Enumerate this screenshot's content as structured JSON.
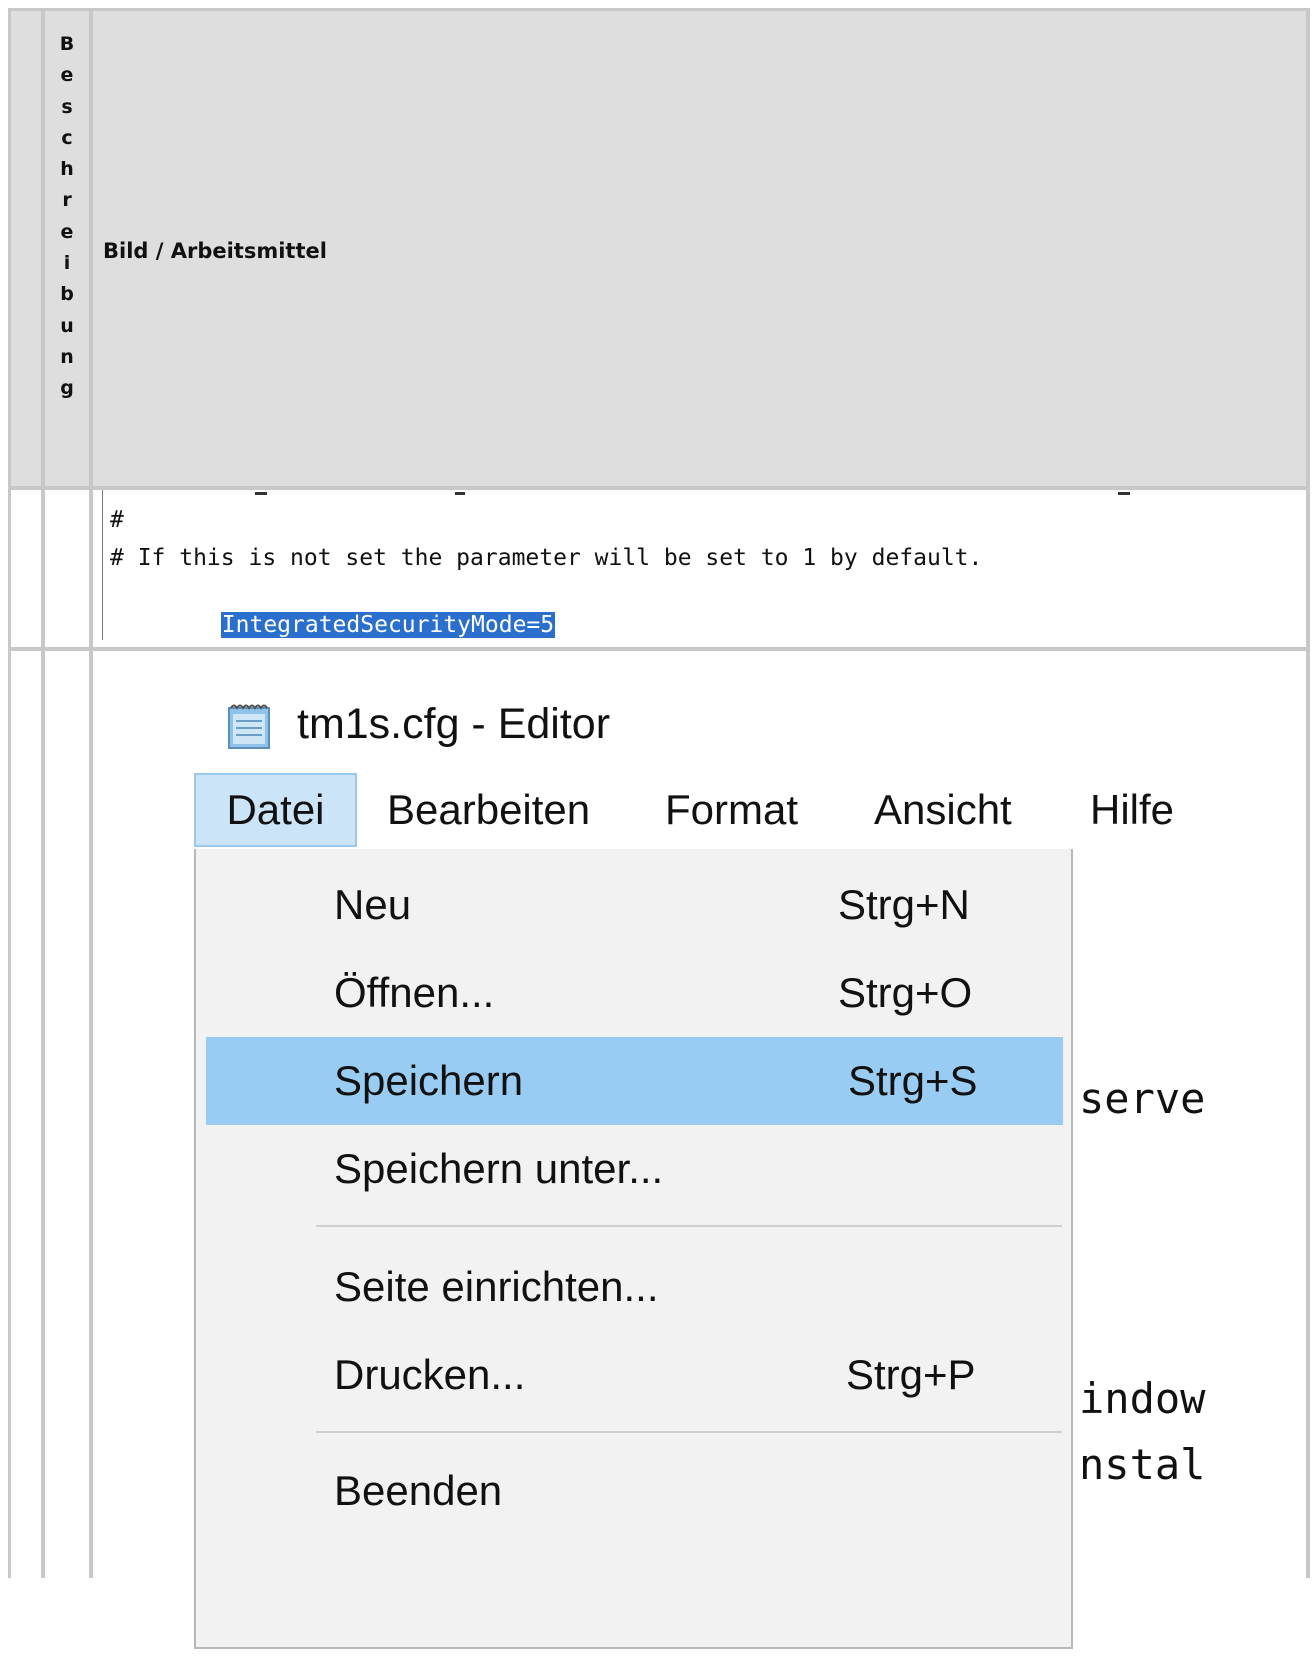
{
  "table": {
    "header": {
      "col2_letters": [
        "B",
        "e",
        "s",
        "c",
        "h",
        "r",
        "e",
        "i",
        "b",
        "u",
        "n",
        "g"
      ],
      "col3_title": "Bild / Arbeitsmittel"
    },
    "code_snippet": {
      "lines": [
        "#",
        "# If this is not set the parameter will be set to 1 by default.",
        "IntegratedSecurityMode=5"
      ]
    },
    "editor_screenshot": {
      "title": "tm1s.cfg - Editor",
      "menu": [
        "Datei",
        "Bearbeiten",
        "Format",
        "Ansicht",
        "Hilfe"
      ],
      "active_menu": "Datei",
      "dropdown": [
        {
          "label": "Neu",
          "shortcut": "Strg+N"
        },
        {
          "label": "Öffnen...",
          "shortcut": "Strg+O"
        },
        {
          "label": "Speichern",
          "shortcut": "Strg+S",
          "highlighted": true
        },
        {
          "label": "Speichern unter...",
          "shortcut": ""
        },
        {
          "label": "Seite einrichten...",
          "shortcut": ""
        },
        {
          "label": "Drucken...",
          "shortcut": "Strg+P"
        },
        {
          "label": "Beenden",
          "shortcut": ""
        }
      ],
      "background_text": [
        "serve",
        "indow",
        "nstal"
      ],
      "highlight_color": "#99ccf2"
    }
  }
}
